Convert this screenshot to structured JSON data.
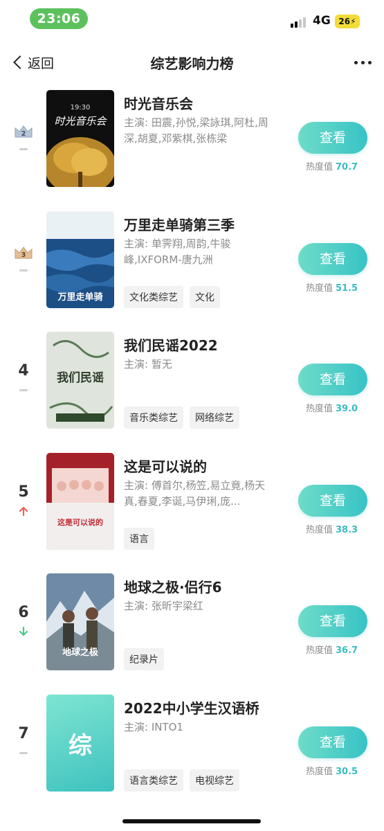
{
  "status_bar": {
    "time": "23:06",
    "network": "4G",
    "battery": "26"
  },
  "nav": {
    "back_label": "返回",
    "title": "综艺影响力榜"
  },
  "view_label": "查看",
  "heat_label": "热度值",
  "items": [
    {
      "rank": "2",
      "title": "时光音乐会",
      "cast": "主演: 田震,孙悦,梁詠琪,阿杜,周深,胡夏,邓紫棋,张栋梁",
      "heat": "70.7",
      "tags": [],
      "trend": "flat",
      "poster_text": "时光音乐会"
    },
    {
      "rank": "3",
      "title": "万里走单骑第三季",
      "cast": "主演: 单霁翔,周韵,牛骏峰,IXFORM-唐九洲",
      "heat": "51.5",
      "tags": [
        "文化类综艺",
        "文化"
      ],
      "trend": "flat",
      "poster_text": "万里走单骑"
    },
    {
      "rank": "4",
      "title": "我们民谣2022",
      "cast": "主演: 暂无",
      "heat": "39.0",
      "tags": [
        "音乐类综艺",
        "网络综艺"
      ],
      "trend": "flat",
      "poster_text": "我们民谣"
    },
    {
      "rank": "5",
      "title": "这是可以说的",
      "cast": "主演: 傅首尔,杨笠,易立竟,杨天真,春夏,李诞,马伊琍,庞...",
      "heat": "38.3",
      "tags": [
        "语言"
      ],
      "trend": "up",
      "poster_text": "这是可以说的"
    },
    {
      "rank": "6",
      "title": "地球之极·侣行6",
      "cast": "主演: 张昕宇梁红",
      "heat": "36.7",
      "tags": [
        "纪录片"
      ],
      "trend": "down",
      "poster_text": "地球之极"
    },
    {
      "rank": "7",
      "title": "2022中小学生汉语桥",
      "cast": "主演: INTO1",
      "heat": "30.5",
      "tags": [
        "语言类综艺",
        "电视综艺"
      ],
      "trend": "flat",
      "poster_text": "综"
    }
  ],
  "colors": {
    "accent": "#3bbcc0",
    "time_pill": "#5cc15d",
    "battery": "#f3dc3a",
    "up": "#f0605a",
    "down": "#4cc98a"
  }
}
